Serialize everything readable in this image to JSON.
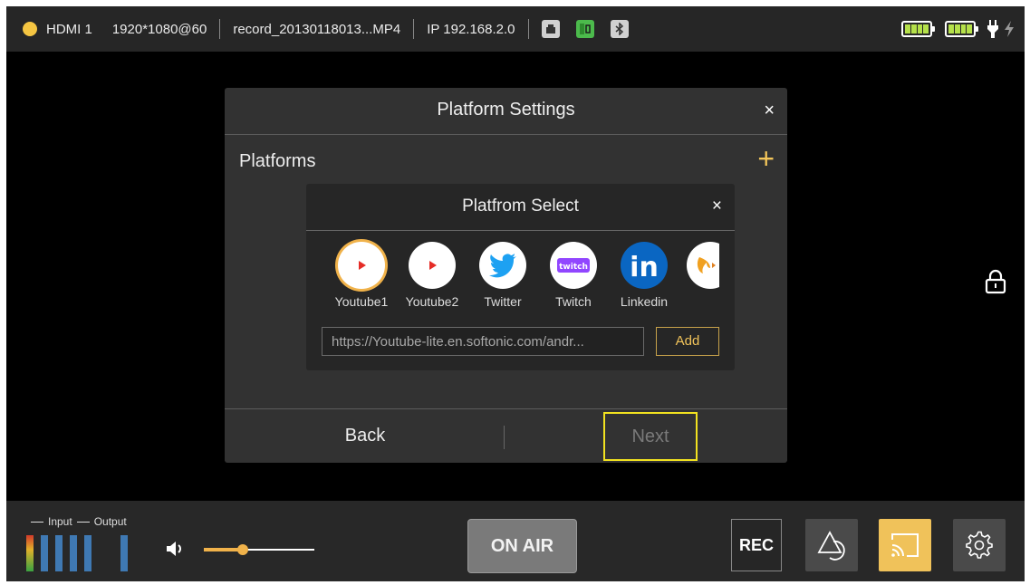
{
  "status_bar": {
    "input": "HDMI 1",
    "resolution": "1920*1080@60",
    "filename": "record_20130118013...MP4",
    "ip": "IP 192.168.2.0",
    "status_color": "#f5c542",
    "icons": [
      "ethernet-icon",
      "sd-card-icon",
      "bluetooth-icon",
      "battery-icon",
      "battery-icon",
      "power-plug-icon",
      "charging-icon"
    ]
  },
  "platform_settings": {
    "title": "Platform Settings",
    "close": "×",
    "platforms_label": "Platforms",
    "add_symbol": "+",
    "back_label": "Back",
    "next_label": "Next"
  },
  "platform_select": {
    "title": "Platfrom Select",
    "close": "×",
    "platforms": [
      {
        "label": "Youtube1",
        "icon": "youtube-icon",
        "color": "#e52d27",
        "selected": true
      },
      {
        "label": "Youtube2",
        "icon": "youtube-icon",
        "color": "#e52d27",
        "selected": false
      },
      {
        "label": "Twitter",
        "icon": "twitter-icon",
        "color": "#1da1f2",
        "selected": false
      },
      {
        "label": "Twitch",
        "icon": "twitch-icon",
        "color": "#9146ff",
        "selected": false
      },
      {
        "label": "Linkedin",
        "icon": "linkedin-icon",
        "color": "#0a66c2",
        "selected": false
      }
    ],
    "url_value": "https://Youtube-lite.en.softonic.com/andr...",
    "add_label": "Add"
  },
  "bottom_bar": {
    "input_label": "Input",
    "output_label": "Output",
    "volume_level": 0.35,
    "on_air_label": "ON AIR",
    "rec_label": "REC",
    "accent_color": "#f0b24a"
  }
}
